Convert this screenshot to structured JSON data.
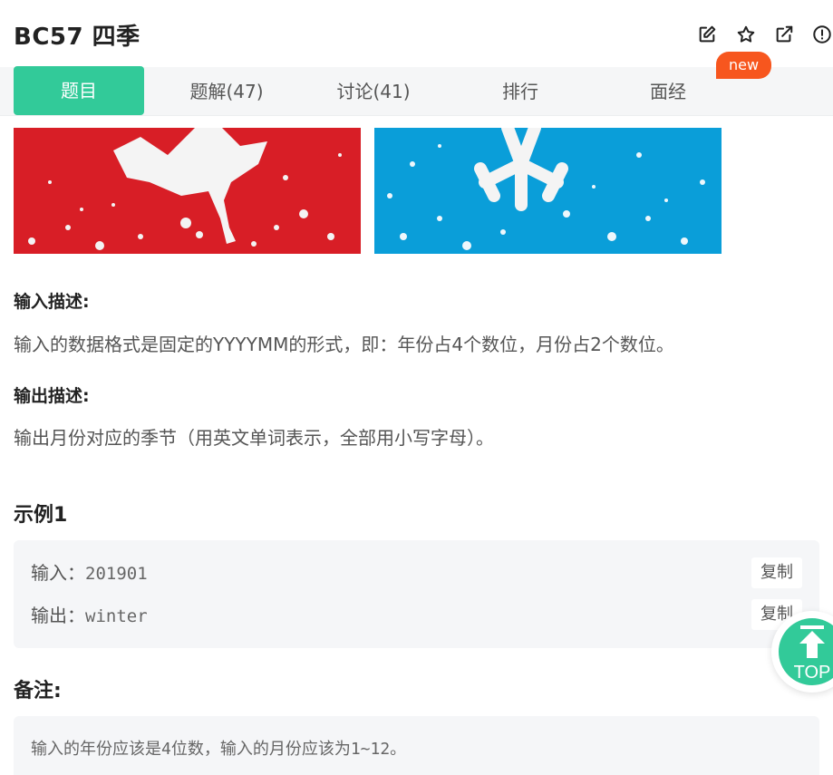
{
  "header": {
    "title": "BC57  四季",
    "icons": [
      "edit-icon",
      "star-icon",
      "external-link-icon",
      "alert-icon"
    ]
  },
  "tabs": [
    {
      "label": "题目",
      "active": true
    },
    {
      "label": "题解(47)",
      "active": false
    },
    {
      "label": "讨论(41)",
      "active": false
    },
    {
      "label": "排行",
      "active": false
    },
    {
      "label": "面经",
      "active": false
    }
  ],
  "badge": {
    "label": "new",
    "color": "#f7561e"
  },
  "colors": {
    "accent": "#32ca99",
    "banner_red": "#d81e26",
    "banner_blue": "#0a9ed9"
  },
  "input_desc": {
    "label": "输入描述:",
    "text": "输入的数据格式是固定的YYYYMM的形式，即：年份占4个数位，月份占2个数位。"
  },
  "output_desc": {
    "label": "输出描述:",
    "text": "输出月份对应的季节（用英文单词表示，全部用小写字母）。"
  },
  "example": {
    "title": "示例1",
    "input_label": "输入：",
    "input_value": "201901",
    "output_label": "输出：",
    "output_value": "winter",
    "copy_label": "复制"
  },
  "note": {
    "title": "备注:",
    "text": "输入的年份应该是4位数，输入的月份应该为1~12。"
  },
  "top_button": {
    "label": "TOP"
  }
}
